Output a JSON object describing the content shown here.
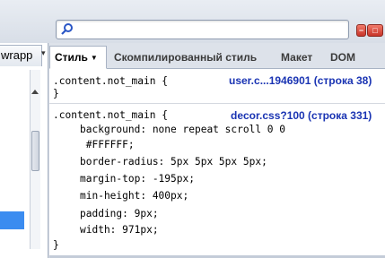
{
  "toolbar": {
    "search": {
      "value": "",
      "placeholder": ""
    },
    "window_buttons": [
      "−",
      "□"
    ]
  },
  "left_panel": {
    "tab_label": "wrapp",
    "tab_arrow": "▾"
  },
  "tabs": [
    {
      "label": "Стиль",
      "arrow": "▼",
      "active": true
    },
    {
      "label": "Скомпилированный стиль",
      "active": false
    },
    {
      "label": "Макет",
      "active": false
    },
    {
      "label": "DOM",
      "active": false
    }
  ],
  "rules": [
    {
      "selector": ".content.not_main {",
      "source": "user.c...1946901 (строка 38)",
      "properties": [],
      "close": "}"
    },
    {
      "selector": ".content.not_main {",
      "source": "decor.css?100 (строка 331)",
      "properties": [
        "background: none repeat scroll 0 0",
        " #FFFFFF;",
        "border-radius: 5px 5px 5px 5px;",
        "margin-top: -195px;",
        "min-height: 400px;",
        "padding: 9px;",
        "width: 971px;"
      ],
      "close": "}"
    }
  ],
  "colors": {
    "source_link": "#1a34b3",
    "selection": "#3b8cf0"
  }
}
